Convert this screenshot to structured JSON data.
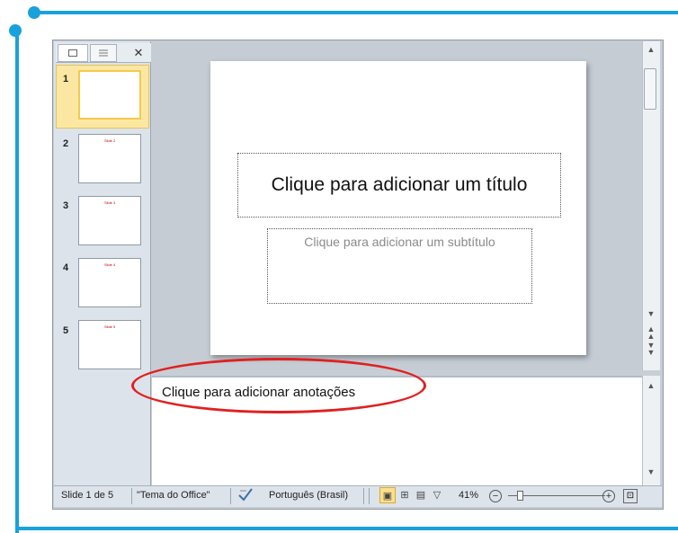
{
  "left_pane": {
    "tab_slides_icon": "slides-tab-icon",
    "tab_outline_icon": "outline-tab-icon",
    "close_glyph": "✕",
    "thumbnails": [
      {
        "number": "1",
        "title": ""
      },
      {
        "number": "2",
        "title": "Slide 2"
      },
      {
        "number": "3",
        "title": "Slide 3"
      },
      {
        "number": "4",
        "title": "Slide 4"
      },
      {
        "number": "5",
        "title": "Slide 5"
      }
    ]
  },
  "slide": {
    "title_placeholder": "Clique para adicionar um título",
    "subtitle_placeholder": "Clique para adicionar um subtítulo"
  },
  "notes": {
    "placeholder": "Clique para adicionar anotações"
  },
  "status_bar": {
    "slide_indicator": "Slide 1 de 5",
    "theme": "\"Tema do Office\"",
    "language": "Português (Brasil)",
    "zoom": "41%",
    "zoom_out": "−",
    "zoom_in": "+"
  },
  "colors": {
    "frame_accent": "#19a1dc",
    "annotation_circle": "#e02020",
    "selected_thumbnail": "#f5c94a"
  }
}
